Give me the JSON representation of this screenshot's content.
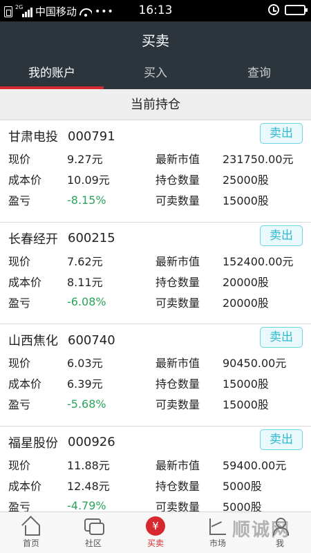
{
  "status_bar": {
    "network": "2G",
    "carrier": "中国移动",
    "time": "16:13",
    "battery_level": 0.6
  },
  "header": {
    "title": "买卖"
  },
  "tabs": [
    {
      "label": "我的账户",
      "active": true
    },
    {
      "label": "买入",
      "active": false
    },
    {
      "label": "查询",
      "active": false
    }
  ],
  "section": {
    "title": "当前持仓"
  },
  "labels": {
    "price": "现价",
    "cost": "成本价",
    "pl": "盈亏",
    "market_value": "最新市值",
    "holding": "持仓数量",
    "sellable": "可卖数量",
    "sell": "卖出"
  },
  "positions": [
    {
      "name": "甘肃电投",
      "code": "000791",
      "price": "9.27元",
      "cost": "10.09元",
      "pl": "-8.15%",
      "market_value": "231750.00元",
      "holding": "25000股",
      "sellable": "15000股"
    },
    {
      "name": "长春经开",
      "code": "600215",
      "price": "7.62元",
      "cost": "8.11元",
      "pl": "-6.08%",
      "market_value": "152400.00元",
      "holding": "20000股",
      "sellable": "20000股"
    },
    {
      "name": "山西焦化",
      "code": "600740",
      "price": "6.03元",
      "cost": "6.39元",
      "pl": "-5.68%",
      "market_value": "90450.00元",
      "holding": "15000股",
      "sellable": "15000股"
    },
    {
      "name": "福星股份",
      "code": "000926",
      "price": "11.88元",
      "cost": "12.48元",
      "pl": "-4.79%",
      "market_value": "59400.00元",
      "holding": "5000股",
      "sellable": "5000股"
    }
  ],
  "bottom_nav": [
    {
      "label": "首页",
      "icon": "home-icon"
    },
    {
      "label": "社区",
      "icon": "chat-icon"
    },
    {
      "label": "买卖",
      "icon": "trade-icon",
      "glyph": "¥",
      "active": true
    },
    {
      "label": "市场",
      "icon": "market-icon"
    },
    {
      "label": "我",
      "icon": "person-icon"
    }
  ],
  "watermark": "顺诚网",
  "colors": {
    "header_bg": "#2c353c",
    "accent_red": "#d8282f",
    "gain_loss_green": "#2aa45a",
    "sell_button": "#2fb8d2"
  }
}
